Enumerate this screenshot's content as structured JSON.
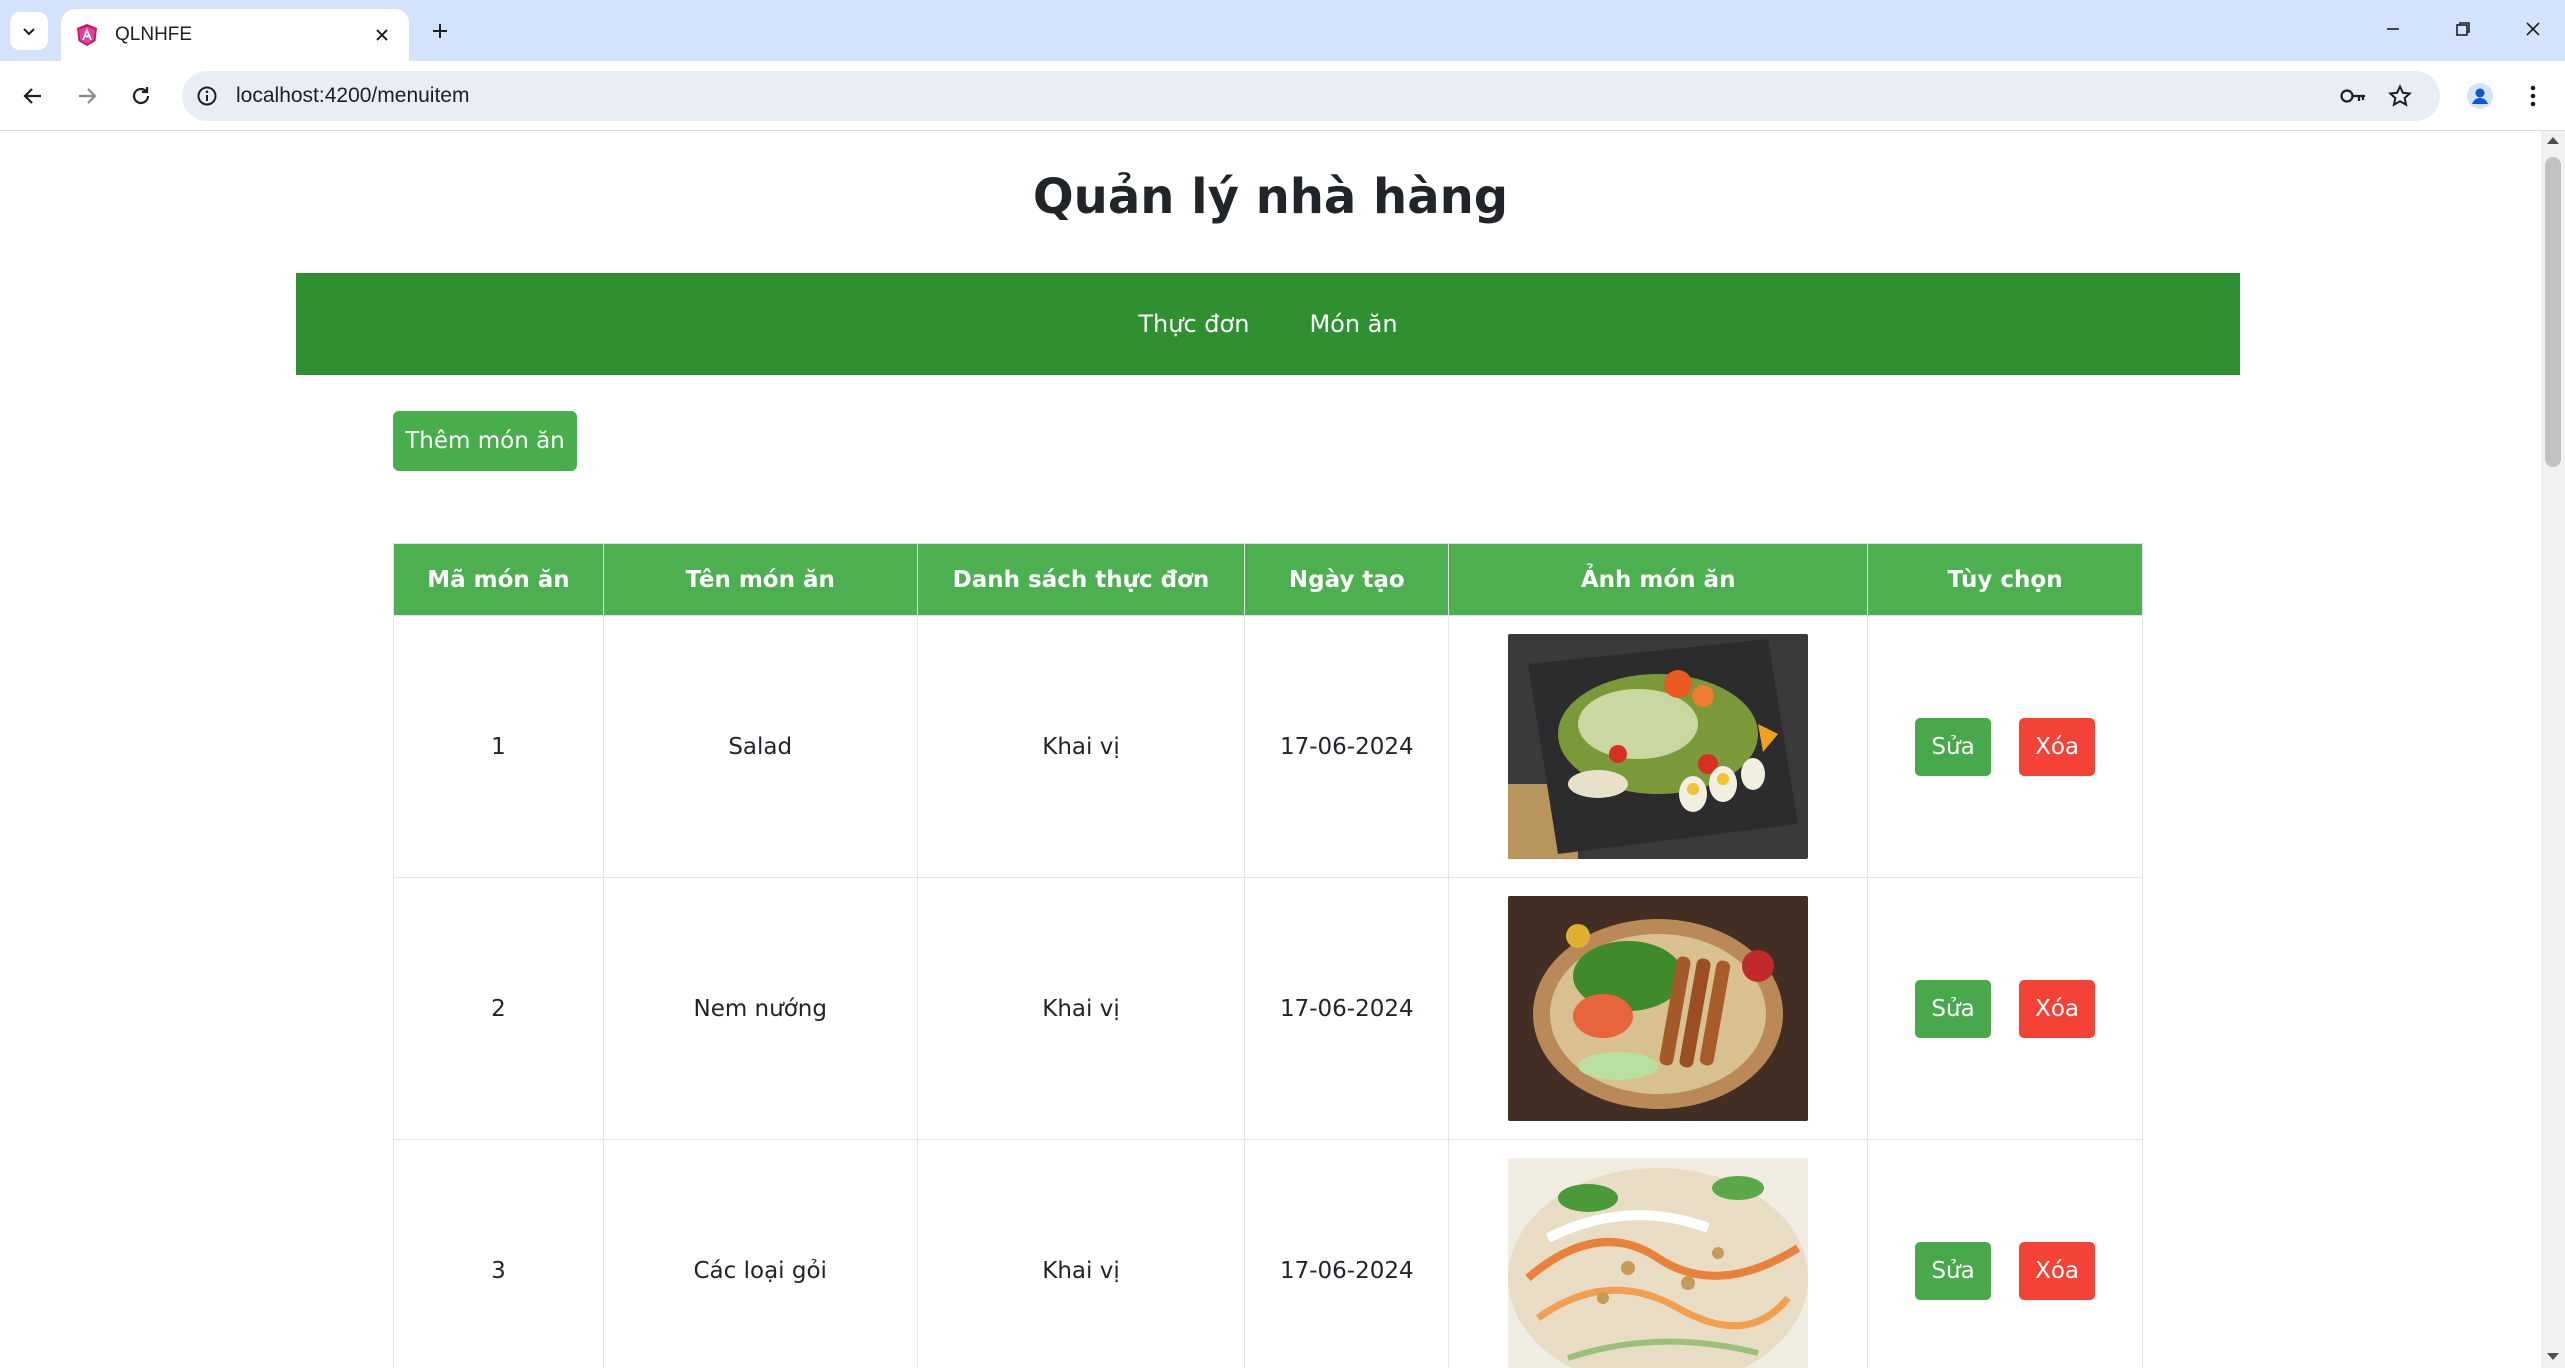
{
  "browser": {
    "tab_title": "QLNHFE",
    "url": "localhost:4200/menuitem"
  },
  "page": {
    "title": "Quản lý nhà hàng",
    "nav": [
      "Thực đơn",
      "Món ăn"
    ],
    "add_button": "Thêm món ăn"
  },
  "table": {
    "headers": [
      "Mã món ăn",
      "Tên món ăn",
      "Danh sách thực đơn",
      "Ngày tạo",
      "Ảnh món ăn",
      "Tùy chọn"
    ],
    "rows": [
      {
        "id": "1",
        "name": "Salad",
        "menu": "Khai vị",
        "date": "17-06-2024",
        "image": "salad-photo",
        "edit": "Sửa",
        "delete": "Xóa"
      },
      {
        "id": "2",
        "name": "Nem nướng",
        "menu": "Khai vị",
        "date": "17-06-2024",
        "image": "nem-nuong-photo",
        "edit": "Sửa",
        "delete": "Xóa"
      },
      {
        "id": "3",
        "name": "Các loại gỏi",
        "menu": "Khai vị",
        "date": "17-06-2024",
        "image": "goi-photo",
        "edit": "Sửa",
        "delete": "Xóa"
      }
    ]
  },
  "colors": {
    "navbar": "#2e9031",
    "header": "#4caf50",
    "edit_button": "#47a94b",
    "delete_button": "#f44336"
  }
}
